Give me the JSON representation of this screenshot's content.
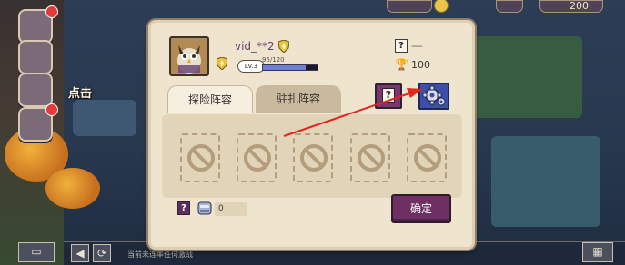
{
  "background": {
    "side_label": "点击",
    "bottom_hint": "当前未连率任何激战",
    "top_amount": "200"
  },
  "panel": {
    "player": {
      "name": "vid_**2",
      "level_label": "Lv.3",
      "xp_text": "95/120",
      "xp_fraction": 0.79
    },
    "rank_placeholder": "----",
    "trophies": "100",
    "tabs": [
      {
        "label": "探险阵容",
        "active": true
      },
      {
        "label": "驻扎阵容",
        "active": false
      }
    ],
    "help_icon_label": "?",
    "slot_count": 5,
    "item_count": "0",
    "confirm_label": "确定"
  },
  "colors": {
    "panel_bg": "#efe5cf",
    "confirm_bg": "#6e2f63",
    "gear_btn_bg": "#3f4fa8",
    "annotation_arrow": "#e0261f"
  }
}
